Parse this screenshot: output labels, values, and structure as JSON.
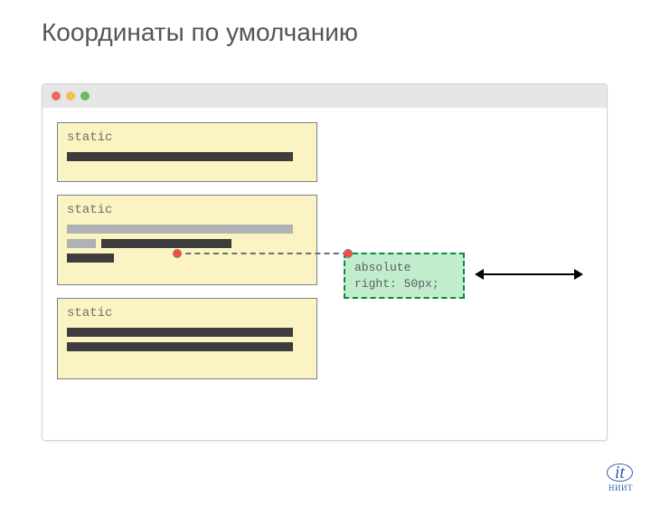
{
  "title": "Координаты по умолчанию",
  "blocks": {
    "b1": {
      "label": "static"
    },
    "b2": {
      "label": "static"
    },
    "b3": {
      "label": "static"
    }
  },
  "absolute_box": {
    "line1": "absolute",
    "line2": "right: 50px;"
  },
  "logo": {
    "mark": "it",
    "sub": "НИИТ"
  }
}
